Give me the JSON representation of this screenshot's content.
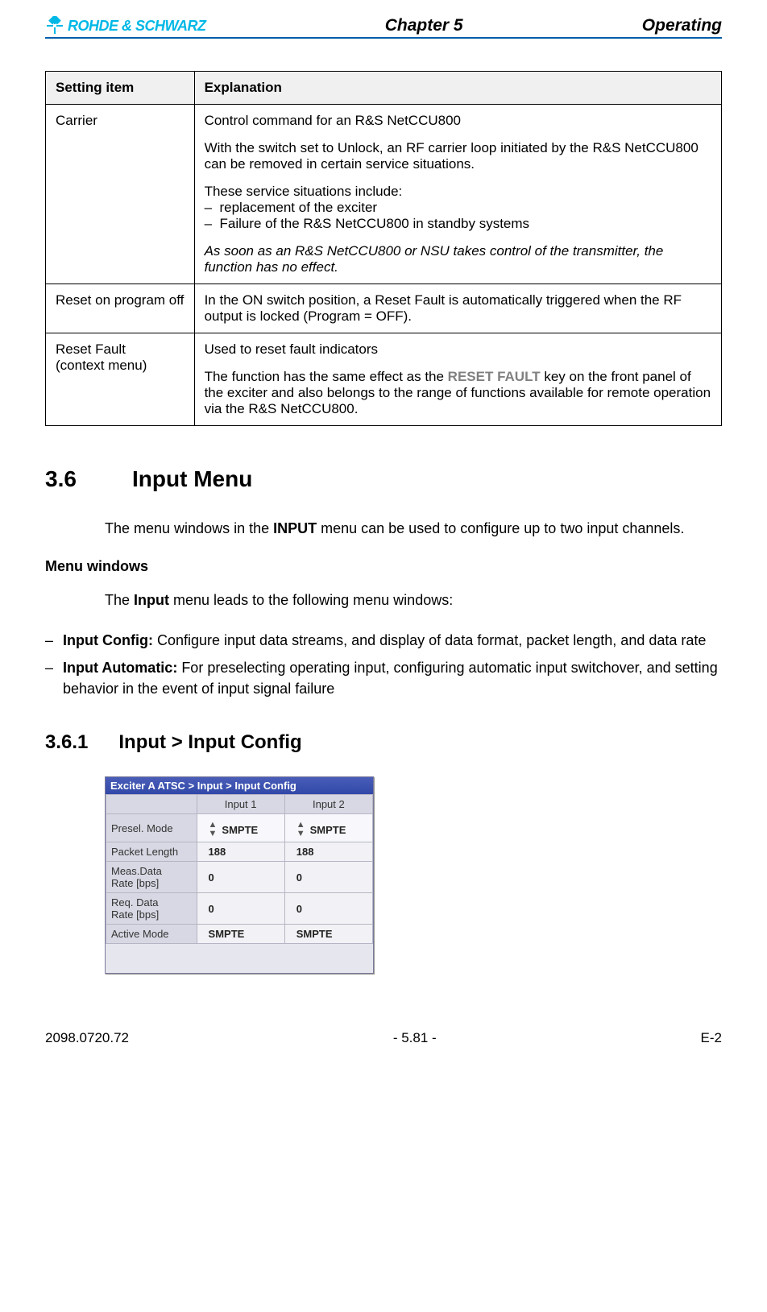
{
  "header": {
    "logo_text": "ROHDE & SCHWARZ",
    "chapter": "Chapter 5",
    "right": "Operating"
  },
  "table": {
    "col1": "Setting item",
    "col2": "Explanation",
    "rows": [
      {
        "item": "Carrier",
        "p1": "Control command for an R&S NetCCU800",
        "p2": "With the switch set to Unlock, an RF carrier loop initiated by the R&S NetCCU800 can be removed in certain service situations.",
        "p3": "These service situations include:",
        "b1": "replacement of the exciter",
        "b2": "Failure of the R&S NetCCU800 in standby systems",
        "p4": "As soon as an R&S NetCCU800 or NSU takes control of the transmitter, the function has no effect."
      },
      {
        "item": "Reset on program off",
        "p1": "In the ON switch position, a Reset Fault is automatically triggered when the RF output is locked (Program = OFF)."
      },
      {
        "item_l1": "Reset Fault",
        "item_l2": "(context menu)",
        "p1": "Used to reset fault indicators",
        "p2a": "The function has the same effect as the ",
        "p2key": "RESET FAULT",
        "p2b": " key on the front panel of the exciter and also belongs to the range of functions available for remote operation via the R&S NetCCU800."
      }
    ]
  },
  "s36": {
    "num": "3.6",
    "title": "Input Menu",
    "intro_a": "The menu windows in the ",
    "intro_b": "INPUT",
    "intro_c": " menu can be used to configure up to two input channels.",
    "mw_title": "Menu windows",
    "mw_body_a": "The ",
    "mw_body_b": "Input",
    "mw_body_c": " menu leads to the following menu windows:",
    "li1_b": "Input Config:",
    "li1_t": " Configure input data streams, and display of data format, packet length, and data rate",
    "li2_b": "Input Automatic:",
    "li2_t": " For preselecting operating input, configuring automatic input switchover, and setting behavior in the event of input signal failure"
  },
  "s361": {
    "num": "3.6.1",
    "title": "Input > Input Config"
  },
  "panel": {
    "title": "Exciter A ATSC  > Input > Input Config",
    "col_empty": "",
    "col1": "Input 1",
    "col2": "Input 2",
    "rows": {
      "r1": {
        "label": "Presel. Mode",
        "v1": "SMPTE",
        "v2": "SMPTE"
      },
      "r2": {
        "label": "Packet Length",
        "v1": "188",
        "v2": "188"
      },
      "r3": {
        "label_l1": "Meas.Data",
        "label_l2": "Rate [bps]",
        "v1": "0",
        "v2": "0"
      },
      "r4": {
        "label_l1": "Req. Data",
        "label_l2": "Rate [bps]",
        "v1": "0",
        "v2": "0"
      },
      "r5": {
        "label": "Active Mode",
        "v1": "SMPTE",
        "v2": "SMPTE"
      }
    }
  },
  "footer": {
    "left": "2098.0720.72",
    "center": "- 5.81 -",
    "right": "E-2"
  }
}
